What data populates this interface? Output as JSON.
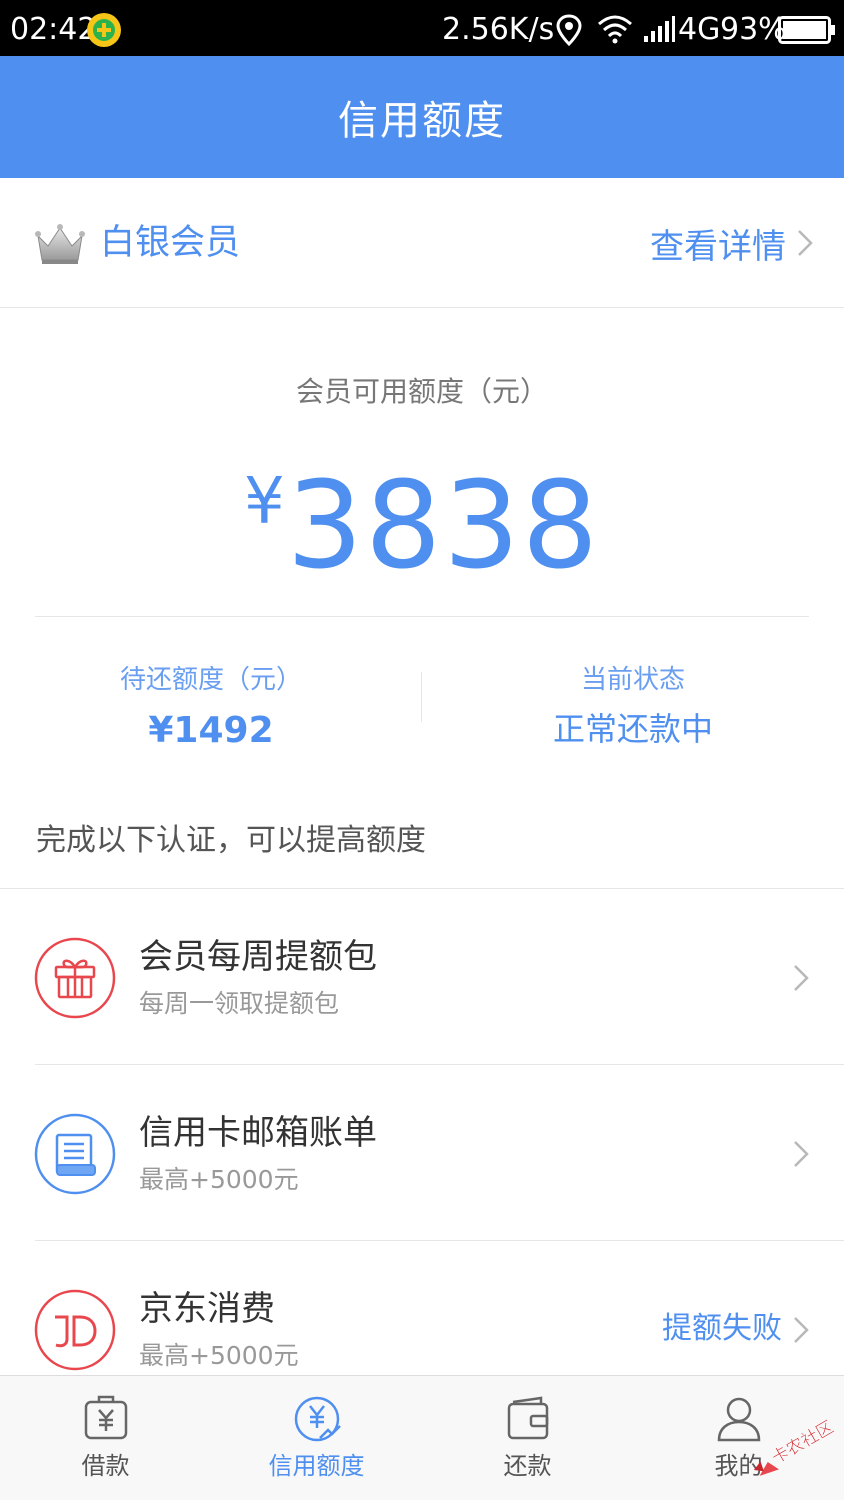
{
  "status_bar": {
    "time": "02:42",
    "speed": "2.56K/s",
    "network": "4G",
    "battery": "93%"
  },
  "header": {
    "title": "信用额度"
  },
  "member": {
    "level": "白银会员",
    "details_label": "查看详情"
  },
  "quota": {
    "label": "会员可用额度（元）",
    "currency": "¥",
    "value": "3838"
  },
  "stats": {
    "pending_label": "待还额度（元）",
    "pending_value": "¥1492",
    "status_label": "当前状态",
    "status_value": "正常还款中"
  },
  "section_hint": "完成以下认证，可以提高额度",
  "items": [
    {
      "title": "会员每周提额包",
      "subtitle": "每周一领取提额包",
      "icon": "gift-icon"
    },
    {
      "title": "信用卡邮箱账单",
      "subtitle": "最高+5000元",
      "icon": "bill-icon"
    },
    {
      "title": "京东消费",
      "subtitle": "最高+5000元",
      "status": "提额失败",
      "icon": "jd-icon"
    }
  ],
  "nav": [
    {
      "label": "借款",
      "icon": "loan-icon"
    },
    {
      "label": "信用额度",
      "icon": "credit-icon",
      "active": true
    },
    {
      "label": "还款",
      "icon": "wallet-icon"
    },
    {
      "label": "我的",
      "icon": "user-icon"
    }
  ],
  "watermark": {
    "text": "卡农社区"
  },
  "colors": {
    "primary": "#4f8fef",
    "red": "#e8474d",
    "text": "#333333",
    "muted": "#999999"
  }
}
